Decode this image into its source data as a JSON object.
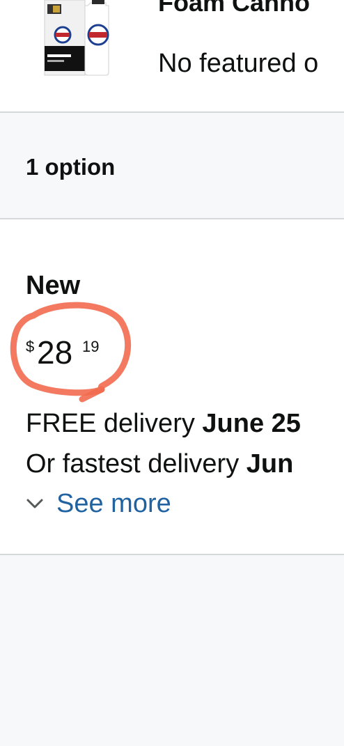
{
  "product": {
    "title": "Foam Canno",
    "subtitle": "No featured o",
    "thumbnail_icon": "foam-cannon-product-image"
  },
  "options": {
    "count_label": "1 option"
  },
  "offer": {
    "condition": "New",
    "price": {
      "symbol": "$",
      "whole": "28",
      "fraction": "19"
    },
    "delivery": {
      "free_prefix": "FREE delivery ",
      "free_date": "June 25",
      "fastest_prefix": "Or fastest delivery ",
      "fastest_date": "Jun"
    },
    "see_more_label": "See more",
    "see_more_icon": "chevron-down-icon"
  },
  "colors": {
    "link": "#2162a1",
    "highlight": "#f26a4f",
    "divider": "#d5d9d9",
    "background": "#f7f8fa"
  }
}
